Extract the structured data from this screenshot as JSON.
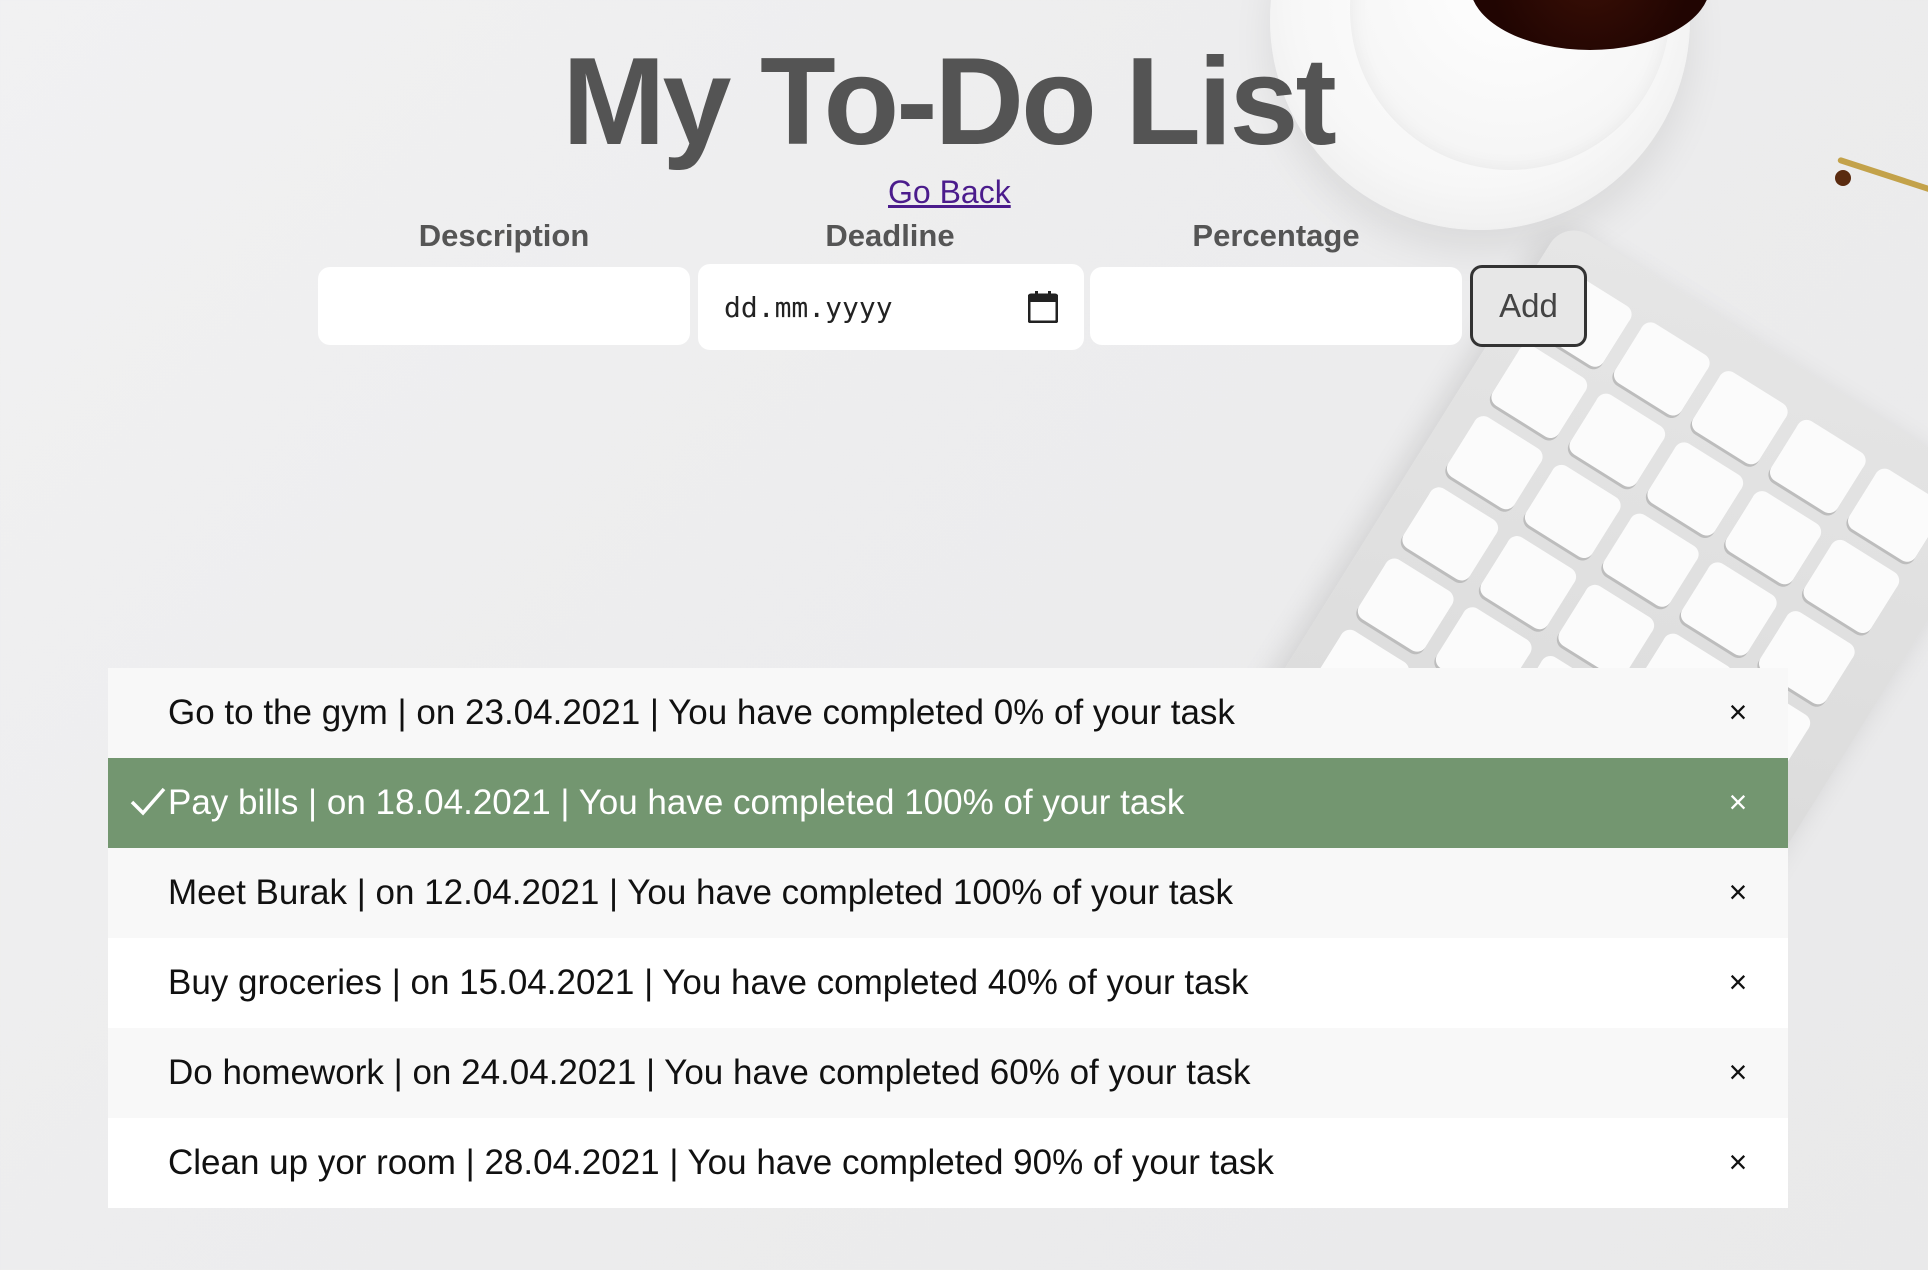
{
  "title": "My To-Do List",
  "go_back": "Go Back",
  "form": {
    "description_label": "Description",
    "deadline_label": "Deadline",
    "percentage_label": "Percentage",
    "deadline_placeholder": "dd.mm.yyyy",
    "add_label": "Add"
  },
  "todos": [
    {
      "text": "Go to the gym | on 23.04.2021 | You have completed 0% of your task",
      "checked": false
    },
    {
      "text": "Pay bills | on 18.04.2021 | You have completed 100% of your task",
      "checked": true
    },
    {
      "text": "Meet Burak | on 12.04.2021 | You have completed 100% of your task",
      "checked": false
    },
    {
      "text": "Buy groceries | on 15.04.2021 | You have completed 40% of your task",
      "checked": false
    },
    {
      "text": "Do homework | on 24.04.2021 | You have completed 60% of your task",
      "checked": false
    },
    {
      "text": "Clean up yor room | 28.04.2021 | You have completed 90% of your task",
      "checked": false
    }
  ],
  "close_symbol": "×",
  "colors": {
    "checked_bg": "#739670",
    "title": "#545454",
    "link": "#4b1c8c"
  }
}
